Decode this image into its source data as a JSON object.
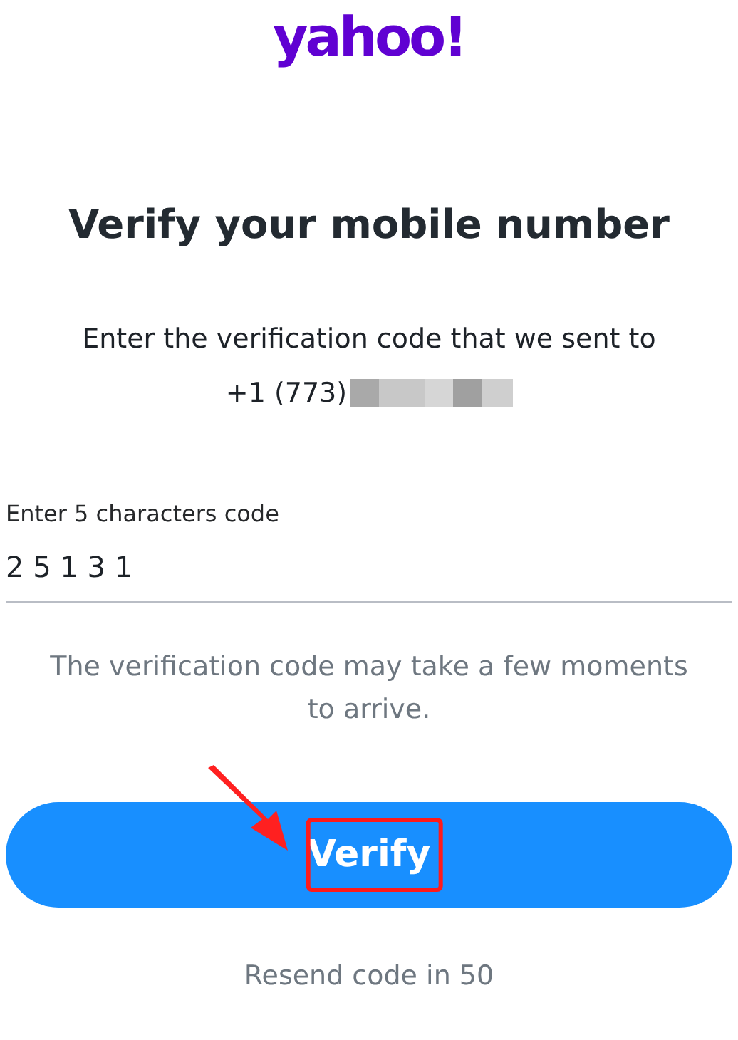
{
  "logo": "yahoo!",
  "title": "Verify your mobile number",
  "instruction": "Enter the verification code that we sent to",
  "phone": {
    "visible": "+1 (773)",
    "redacted": true
  },
  "code_field": {
    "label": "Enter 5 characters code",
    "value": "2 5 1 3 1"
  },
  "hint": "The verification code may take a few moments to arrive.",
  "verify_button": {
    "label": "Verify",
    "highlighted": true
  },
  "resend": "Resend code in 50"
}
